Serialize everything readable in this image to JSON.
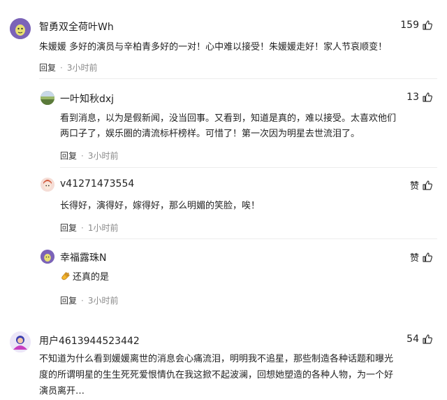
{
  "comments": [
    {
      "user": "智勇双全荷叶Wh",
      "likes": "159",
      "text": "朱媛媛 多好的演员与辛柏青多好的一对！心中难以接受！朱媛媛走好！家人节哀顺变！",
      "reply_label": "回复",
      "time": "3小时前",
      "replies": [
        {
          "user": "一叶知秋dxj",
          "likes": "13",
          "text_line1": "看到消息，以为是假新闻，没当回事。又看到，知道是真的，难以接受。太喜欢他们",
          "text_line2": "两口子了，娱乐圈的清流标杆榜样。可惜了！第一次因为明星去世流泪了。",
          "reply_label": "回复",
          "time": "3小时前"
        },
        {
          "user": "v41271473554",
          "likes": "赞",
          "text": "长得好，演得好，嫁得好，那么明媚的笑脸，唉！",
          "reply_label": "回复",
          "time": "1小时前"
        },
        {
          "user": "幸福露珠N",
          "likes": "赞",
          "text": "还真的是",
          "emoji": "clapping-hands-emoji",
          "reply_label": "回复",
          "time": "3小时前"
        }
      ]
    },
    {
      "user": "用户4613944523442",
      "likes": "54",
      "text_line1": "不知道为什么看到媛媛离世的消息会心痛流泪，明明我不追星，那些制造各种话题和曝光",
      "text_line2": "度的所谓明星的生生死死爱恨情仇在我这掀不起波澜，回想她塑造的各种人物，为一个好",
      "text_line3": "演员离开…"
    }
  ],
  "icons": {
    "like": "thumbs-up-icon"
  },
  "colors": {
    "text": "#222222",
    "muted": "#8a8a8a",
    "divider": "#ededed"
  }
}
